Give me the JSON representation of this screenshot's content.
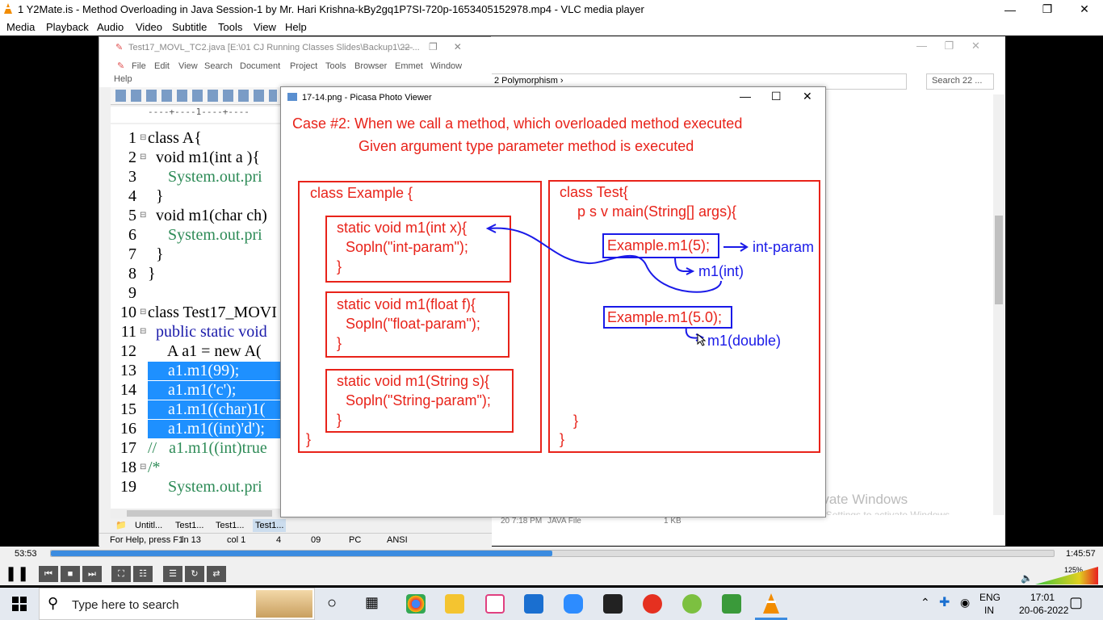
{
  "window": {
    "title": "1 Y2Mate.is - Method Overloading in Java  Session-1  by Mr. Hari Krishna-kBy2gq1P7SI-720p-1653405152978.mp4 - VLC media player"
  },
  "menu": [
    "Media",
    "Playback",
    "Audio",
    "Video",
    "Subtitle",
    "Tools",
    "View",
    "Help"
  ],
  "npp": {
    "title": "Test17_MOVL_TC2.java [E:\\01 CJ Running Classes Slides\\Backup1\\22 ...",
    "menu": [
      "File",
      "Edit",
      "View",
      "Search",
      "Document",
      "Project",
      "Tools",
      "Browser",
      "Emmet",
      "Window",
      "Help"
    ],
    "ruler": "----+----1----+----",
    "lines": [
      {
        "n": "1",
        "t": "class A{"
      },
      {
        "n": "2",
        "t": "  void m1(int a ){"
      },
      {
        "n": "3",
        "t": "     System.out.pri"
      },
      {
        "n": "4",
        "t": "  }"
      },
      {
        "n": "5",
        "t": "  void m1(char ch)"
      },
      {
        "n": "6",
        "t": "     System.out.pri"
      },
      {
        "n": "7",
        "t": "  }"
      },
      {
        "n": "8",
        "t": "}"
      },
      {
        "n": "9",
        "t": ""
      },
      {
        "n": "10",
        "t": "class Test17_MOVI"
      },
      {
        "n": "11",
        "t": "  public static void"
      },
      {
        "n": "12",
        "t": "     A a1 = new A("
      },
      {
        "n": "13",
        "t": "     a1.m1(99);"
      },
      {
        "n": "14",
        "t": "     a1.m1('c');"
      },
      {
        "n": "15",
        "t": "     a1.m1((char)1("
      },
      {
        "n": "16",
        "t": "     a1.m1((int)'d');"
      },
      {
        "n": "17",
        "t": "//   a1.m1((int)true"
      },
      {
        "n": "18",
        "t": "/*"
      },
      {
        "n": "19",
        "t": "     System.out.pri"
      }
    ],
    "tabs": [
      "Untitl...",
      "Test1...",
      "Test1...",
      "Test1..."
    ],
    "status": {
      "help": "For Help, press F1",
      "ln": "ln 13",
      "col": "col 1",
      "a": "4",
      "b": "09",
      "pc": "PC",
      "enc": "ANSI"
    }
  },
  "explorer": {
    "breadcrumb": "2 Polymorphism",
    "search": "Search 22 ...",
    "date": "20 7:18 PM",
    "type": "JAVA File",
    "size": "1 KB",
    "watermark1": "Activate Windows",
    "watermark2": "Go to Settings to activate Windows."
  },
  "picasa": {
    "title": "17-14.png - Picasa Photo Viewer",
    "heading1": "Case #2: When we call a method, which overloaded method executed",
    "heading2": "Given argument type parameter method is executed",
    "left": {
      "header": "class Example {",
      "m1_sig": "static void m1(int x){",
      "m1_body": "Sopln(\"int-param\");",
      "m2_sig": "static void m1(float f){",
      "m2_body": "Sopln(\"float-param\");",
      "m3_sig": "static void m1(String s){",
      "m3_body": "Sopln(\"String-param\");",
      "close": "}",
      "close_outer": "}"
    },
    "right": {
      "header": "class Test{",
      "main": "p s v main(String[] args){",
      "call1": "Example.m1(5);",
      "result1": "int-param",
      "note1": "m1(int)",
      "call2": "Example.m1(5.0);",
      "note2": "m1(double)",
      "close_inner": "}",
      "close_outer": "}"
    }
  },
  "player": {
    "elapsed": "53:53",
    "total": "1:45:57",
    "progress": 0.5,
    "volume": "125%"
  },
  "taskbar": {
    "search_placeholder": "Type here to search",
    "lang": "ENG",
    "region": "IN",
    "time": "17:01",
    "date": "20-06-2022"
  }
}
